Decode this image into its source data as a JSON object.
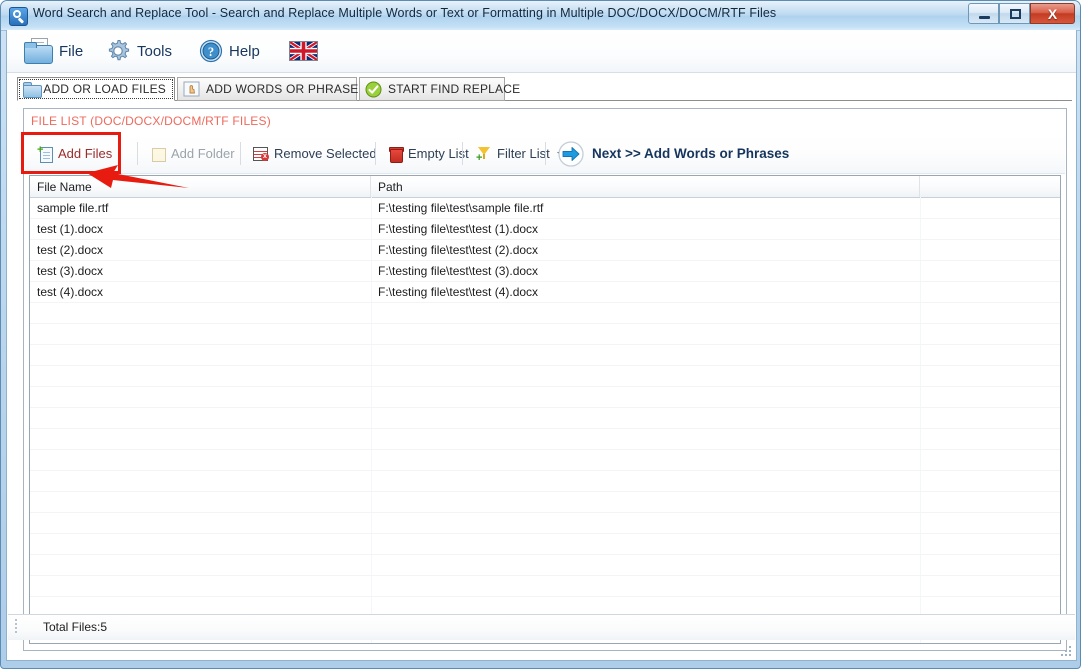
{
  "window": {
    "title": "Word Search and Replace Tool - Search and Replace Multiple Words or Text  or Formatting in Multiple DOC/DOCX/DOCM/RTF Files",
    "app_icon": "magnifier-icon",
    "controls": {
      "minimize": "minimize-button",
      "maximize": "maximize-button",
      "close_label": "X"
    },
    "accent_colors": {
      "title_bar": "#bcd9f0",
      "close_button": "#c23c24",
      "panel_title": "#ee6a5c",
      "annotation": "#e81b10",
      "next_label": "#15355e"
    }
  },
  "menu": {
    "items": [
      {
        "label": "File",
        "icon": "folder-icon"
      },
      {
        "label": "Tools",
        "icon": "gear-icon"
      },
      {
        "label": "Help",
        "icon": "question-circle-icon"
      },
      {
        "label": "",
        "icon": "uk-flag-icon"
      }
    ]
  },
  "tabs": [
    {
      "label": "ADD OR LOAD FILES",
      "icon": "folder-icon",
      "active": true
    },
    {
      "label": "ADD WORDS OR PHRASES",
      "icon": "hand-pointer-icon",
      "active": false
    },
    {
      "label": "START FIND REPLACE",
      "icon": "green-check-icon",
      "active": false
    }
  ],
  "panel": {
    "title": "FILE LIST (DOC/DOCX/DOCM/RTF FILES)"
  },
  "toolbar": {
    "buttons": [
      {
        "label": "Add Files",
        "icon": "add-file-icon",
        "state": "highlighted"
      },
      {
        "label": "Add Folder",
        "icon": "add-folder-icon",
        "state": "disabled"
      },
      {
        "label": "Remove Selected",
        "icon": "remove-row-icon",
        "state": "normal"
      },
      {
        "label": "Empty List",
        "icon": "trash-can-icon",
        "state": "normal"
      },
      {
        "label": "Filter List",
        "icon": "filter-funnel-icon",
        "state": "normal",
        "has_dropdown": true
      },
      {
        "label": "Next >> Add Words or Phrases",
        "icon": "blue-right-arrow-icon",
        "state": "emphasis"
      }
    ]
  },
  "file_list": {
    "columns": [
      "File Name",
      "Path",
      ""
    ],
    "rows": [
      {
        "name": "sample file.rtf",
        "path": "F:\\testing file\\test\\sample file.rtf",
        "extra": ""
      },
      {
        "name": "test (1).docx",
        "path": "F:\\testing file\\test\\test (1).docx",
        "extra": ""
      },
      {
        "name": "test (2).docx",
        "path": "F:\\testing file\\test\\test (2).docx",
        "extra": ""
      },
      {
        "name": "test (3).docx",
        "path": "F:\\testing file\\test\\test (3).docx",
        "extra": ""
      },
      {
        "name": "test (4).docx",
        "path": "F:\\testing file\\test\\test (4).docx",
        "extra": ""
      }
    ]
  },
  "status": {
    "text": "Total Files:5"
  }
}
